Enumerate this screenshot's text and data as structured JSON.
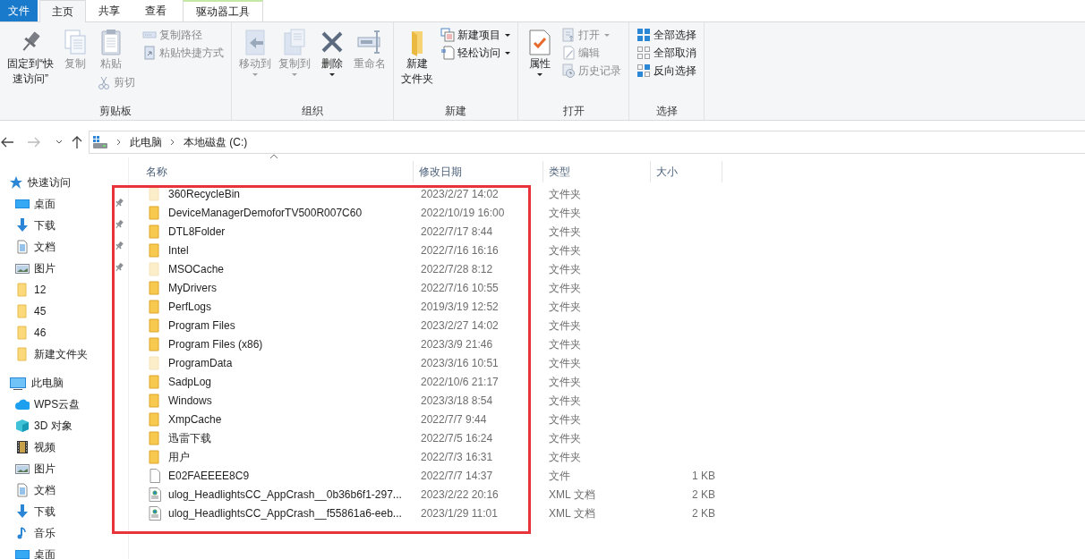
{
  "tabs": [
    {
      "label": "文件",
      "kind": "file",
      "selected": false
    },
    {
      "label": "主页",
      "kind": "normal",
      "selected": true
    },
    {
      "label": "共享",
      "kind": "normal",
      "selected": false
    },
    {
      "label": "查看",
      "kind": "normal",
      "selected": false
    },
    {
      "label": "驱动器工具",
      "kind": "context",
      "selected": false
    }
  ],
  "ribbon": {
    "groups": [
      {
        "label": "剪贴板",
        "columns": [
          {
            "buttons": [
              {
                "label": [
                  "固定到“快",
                  "速访问”"
                ],
                "large": true,
                "kind": "pin",
                "disabled": false,
                "dropdown": false
              }
            ]
          },
          {
            "buttons": [
              {
                "label": [
                  "复制"
                ],
                "large": true,
                "kind": "copy",
                "disabled": true,
                "dropdown": false
              }
            ]
          },
          {
            "buttons": [
              {
                "label": [
                  "粘贴"
                ],
                "large": true,
                "kind": "paste",
                "disabled": true,
                "dropdown": false
              },
              {
                "label": [
                  "剪切"
                ],
                "large": false,
                "kind": "cut",
                "disabled": true,
                "dropdown": false
              }
            ]
          },
          {
            "buttons": [
              {
                "label": [
                  "复制路径"
                ],
                "large": false,
                "kind": "copy-path",
                "disabled": true,
                "dropdown": false
              },
              {
                "label": [
                  "粘贴快捷方式"
                ],
                "large": false,
                "kind": "paste-shortcut",
                "disabled": true,
                "dropdown": false
              }
            ]
          }
        ]
      },
      {
        "label": "组织",
        "columns": [
          {
            "buttons": [
              {
                "label": [
                  "移动到"
                ],
                "large": true,
                "kind": "move-to",
                "disabled": true,
                "dropdown": true
              }
            ]
          },
          {
            "buttons": [
              {
                "label": [
                  "复制到"
                ],
                "large": true,
                "kind": "copy-to",
                "disabled": true,
                "dropdown": true
              }
            ]
          },
          {
            "buttons": [
              {
                "label": [
                  "删除"
                ],
                "large": true,
                "kind": "delete",
                "disabled": false,
                "dropdown": true
              }
            ]
          },
          {
            "buttons": [
              {
                "label": [
                  "重命名"
                ],
                "large": true,
                "kind": "rename",
                "disabled": true,
                "dropdown": false
              }
            ]
          }
        ]
      },
      {
        "label": "新建",
        "columns": [
          {
            "buttons": [
              {
                "label": [
                  "新建",
                  "文件夹"
                ],
                "large": true,
                "kind": "new-folder",
                "disabled": false,
                "dropdown": false
              }
            ]
          },
          {
            "buttons": [
              {
                "label": [
                  "新建项目"
                ],
                "large": false,
                "kind": "new-item",
                "disabled": false,
                "dropdown": true
              },
              {
                "label": [
                  "轻松访问"
                ],
                "large": false,
                "kind": "easy-access",
                "disabled": false,
                "dropdown": true
              }
            ]
          }
        ]
      },
      {
        "label": "打开",
        "columns": [
          {
            "buttons": [
              {
                "label": [
                  "属性"
                ],
                "large": true,
                "kind": "properties",
                "disabled": false,
                "dropdown": true
              }
            ]
          },
          {
            "buttons": [
              {
                "label": [
                  "打开"
                ],
                "large": false,
                "kind": "open",
                "disabled": true,
                "dropdown": true
              },
              {
                "label": [
                  "编辑"
                ],
                "large": false,
                "kind": "edit",
                "disabled": true,
                "dropdown": false
              },
              {
                "label": [
                  "历史记录"
                ],
                "large": false,
                "kind": "history",
                "disabled": true,
                "dropdown": false
              }
            ]
          }
        ]
      },
      {
        "label": "选择",
        "columns": [
          {
            "buttons": [
              {
                "label": [
                  "全部选择"
                ],
                "large": false,
                "kind": "select-all",
                "disabled": false,
                "dropdown": false
              },
              {
                "label": [
                  "全部取消"
                ],
                "large": false,
                "kind": "select-none",
                "disabled": false,
                "dropdown": false
              },
              {
                "label": [
                  "反向选择"
                ],
                "large": false,
                "kind": "invert",
                "disabled": false,
                "dropdown": false
              }
            ]
          }
        ]
      }
    ]
  },
  "navigation": {
    "back_enabled": true,
    "forward_enabled": false
  },
  "address": {
    "segments": [
      "此电脑",
      "本地磁盘 (C:)"
    ]
  },
  "sidebar": {
    "sections": [
      {
        "label": "快速访问",
        "kind": "star",
        "children": [
          {
            "label": "桌面",
            "kind": "desktop",
            "pinned": true
          },
          {
            "label": "下载",
            "kind": "download",
            "pinned": true
          },
          {
            "label": "文档",
            "kind": "document",
            "pinned": true
          },
          {
            "label": "图片",
            "kind": "pictures",
            "pinned": true
          },
          {
            "label": "12",
            "kind": "folder",
            "pinned": false
          },
          {
            "label": "45",
            "kind": "folder",
            "pinned": false
          },
          {
            "label": "46",
            "kind": "folder",
            "pinned": false
          },
          {
            "label": "新建文件夹",
            "kind": "folder",
            "pinned": false
          }
        ]
      },
      {
        "label": "此电脑",
        "kind": "computer",
        "children": [
          {
            "label": "WPS云盘",
            "kind": "cloud",
            "pinned": false
          },
          {
            "label": "3D 对象",
            "kind": "cube",
            "pinned": false
          },
          {
            "label": "视频",
            "kind": "video",
            "pinned": false
          },
          {
            "label": "图片",
            "kind": "pictures",
            "pinned": false
          },
          {
            "label": "文档",
            "kind": "document",
            "pinned": false
          },
          {
            "label": "下载",
            "kind": "download",
            "pinned": false
          },
          {
            "label": "音乐",
            "kind": "music",
            "pinned": false
          },
          {
            "label": "桌面",
            "kind": "desktop",
            "pinned": false
          }
        ]
      }
    ]
  },
  "table": {
    "columns": [
      {
        "label": "名称",
        "sorted": true
      },
      {
        "label": "修改日期",
        "sorted": false
      },
      {
        "label": "类型",
        "sorted": false
      },
      {
        "label": "大小",
        "sorted": false
      }
    ],
    "rows": [
      {
        "name": "360RecycleBin",
        "modified": "2023/2/27 14:02",
        "type": "文件夹",
        "kind": "folder",
        "hidden": true
      },
      {
        "name": "DeviceManagerDemoforTV500R007C60",
        "modified": "2022/10/19 16:00",
        "type": "文件夹",
        "kind": "folder",
        "hidden": false
      },
      {
        "name": "DTL8Folder",
        "modified": "2022/7/17 8:44",
        "type": "文件夹",
        "kind": "folder",
        "hidden": false
      },
      {
        "name": "Intel",
        "modified": "2022/7/16 16:16",
        "type": "文件夹",
        "kind": "folder",
        "hidden": false
      },
      {
        "name": "MSOCache",
        "modified": "2022/7/28 8:12",
        "type": "文件夹",
        "kind": "folder",
        "hidden": true
      },
      {
        "name": "MyDrivers",
        "modified": "2022/7/16 10:55",
        "type": "文件夹",
        "kind": "folder",
        "hidden": false
      },
      {
        "name": "PerfLogs",
        "modified": "2019/3/19 12:52",
        "type": "文件夹",
        "kind": "folder",
        "hidden": false
      },
      {
        "name": "Program Files",
        "modified": "2023/2/27 14:02",
        "type": "文件夹",
        "kind": "folder",
        "hidden": false
      },
      {
        "name": "Program Files (x86)",
        "modified": "2023/3/9 21:46",
        "type": "文件夹",
        "kind": "folder",
        "hidden": false
      },
      {
        "name": "ProgramData",
        "modified": "2023/3/16 10:51",
        "type": "文件夹",
        "kind": "folder",
        "hidden": true
      },
      {
        "name": "SadpLog",
        "modified": "2022/10/6 21:17",
        "type": "文件夹",
        "kind": "folder",
        "hidden": false
      },
      {
        "name": "Windows",
        "modified": "2023/3/18 8:54",
        "type": "文件夹",
        "kind": "folder",
        "hidden": false
      },
      {
        "name": "XmpCache",
        "modified": "2022/7/7 9:44",
        "type": "文件夹",
        "kind": "folder",
        "hidden": false
      },
      {
        "name": "迅雷下载",
        "modified": "2022/7/5 16:24",
        "type": "文件夹",
        "kind": "folder",
        "hidden": false
      },
      {
        "name": "用户",
        "modified": "2022/7/3 16:31",
        "type": "文件夹",
        "kind": "folder",
        "hidden": false
      },
      {
        "name": "E02FAEEEE8C9",
        "modified": "2022/7/7 14:37",
        "type": "文件",
        "size": "1 KB",
        "kind": "file",
        "hidden": false
      },
      {
        "name": "ulog_HeadlightsCC_AppCrash__0b36b6f1-297...",
        "modified": "2023/2/22 20:16",
        "type": "XML 文档",
        "size": "2 KB",
        "kind": "xml",
        "hidden": false
      },
      {
        "name": "ulog_HeadlightsCC_AppCrash__f55861a6-eeb...",
        "modified": "2023/1/29 11:01",
        "type": "XML 文档",
        "size": "2 KB",
        "kind": "xml",
        "hidden": false
      }
    ]
  },
  "annotation_frame": {
    "shown": true
  }
}
